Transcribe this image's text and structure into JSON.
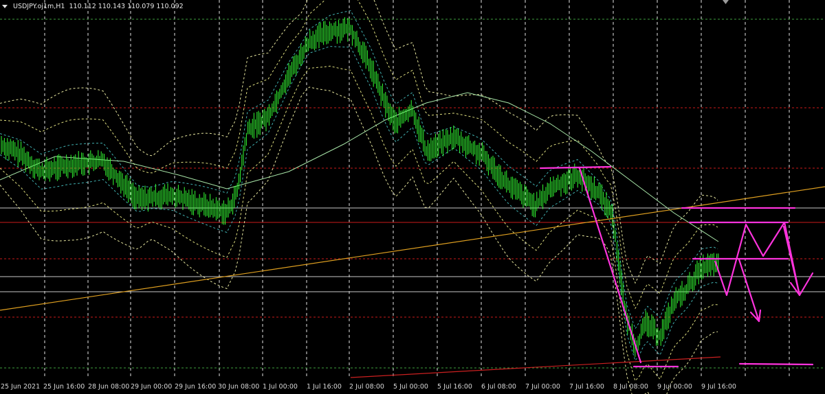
{
  "window": {
    "symbol_label": "USDJPY.oj1m,H1",
    "ohlc_label": "110.112 110.143 110.079 110.092"
  },
  "x_axis": {
    "labels": [
      "25 Jun 2021",
      "25 Jun 16:00",
      "28 Jun 08:00",
      "29 Jun 00:00",
      "29 Jun 16:00",
      "30 Jun 08:00",
      "1 Jul 00:00",
      "1 Jul 16:00",
      "2 Jul 08:00",
      "5 Jul 00:00",
      "5 Jul 16:00",
      "6 Jul 08:00",
      "7 Jul 00:00",
      "7 Jul 16:00",
      "8 Jul 08:00",
      "9 Jul 00:00",
      "9 Jul 16:00"
    ]
  },
  "colors": {
    "background": "#000000",
    "candles": "#33ff33",
    "grid": "#cfcfcf",
    "hline_white": "#c8c8c8",
    "hline_red": "#cc1a1a",
    "hline_green": "#3fa03f",
    "trendline_orange": "#e0a020",
    "trendline_red": "#cc2020",
    "moving_average": "#a8e6a8",
    "envelope_outer": "#e8e8a0",
    "envelope_middle": "#e0e080",
    "envelope_inner": "#40b0b0",
    "annotation": "#ff33dd"
  },
  "chart_data": {
    "type": "candlestick",
    "symbol": "USDJPY.oj1m",
    "timeframe": "H1",
    "last_bar": {
      "open": 110.112,
      "high": 110.143,
      "low": 110.079,
      "close": 110.092
    },
    "x_tick_labels": [
      "25 Jun 2021",
      "25 Jun 16:00",
      "28 Jun 08:00",
      "29 Jun 00:00",
      "29 Jun 16:00",
      "30 Jun 08:00",
      "1 Jul 00:00",
      "1 Jul 16:00",
      "2 Jul 08:00",
      "5 Jul 00:00",
      "5 Jul 16:00",
      "6 Jul 08:00",
      "7 Jul 00:00",
      "7 Jul 16:00",
      "8 Jul 08:00",
      "9 Jul 00:00",
      "9 Jul 16:00"
    ],
    "grid": true,
    "indicators": [
      "moving average",
      "envelope bands (outer, middle, inner)"
    ],
    "annotations": [
      "horizontal resistance lines",
      "projected zigzag path with arrows",
      "rising trendlines"
    ]
  }
}
